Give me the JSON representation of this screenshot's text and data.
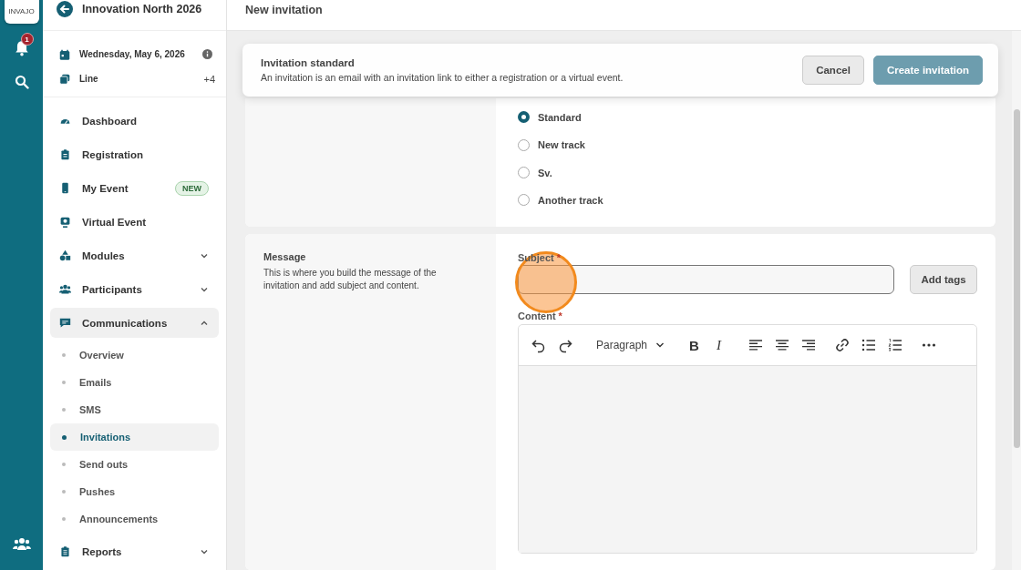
{
  "app": {
    "logo": "INVAJO",
    "notification_count": "1"
  },
  "sidebar": {
    "event_title": "Innovation North 2026",
    "date": "Wednesday, May 6, 2026",
    "line": {
      "label": "Line",
      "extra": "+4"
    },
    "items": [
      {
        "label": "Dashboard",
        "selected": false
      },
      {
        "label": "Registration",
        "selected": false
      },
      {
        "label": "My Event",
        "badge": "NEW",
        "selected": false
      },
      {
        "label": "Virtual Event",
        "selected": false
      },
      {
        "label": "Modules",
        "expanded": false,
        "selected": false
      },
      {
        "label": "Participants",
        "expanded": false,
        "selected": false
      },
      {
        "label": "Communications",
        "expanded": true,
        "selected": false,
        "children": [
          {
            "label": "Overview",
            "selected": false
          },
          {
            "label": "Emails",
            "selected": false
          },
          {
            "label": "SMS",
            "selected": false
          },
          {
            "label": "Invitations",
            "selected": true
          },
          {
            "label": "Send outs",
            "selected": false
          },
          {
            "label": "Pushes",
            "selected": false
          },
          {
            "label": "Announcements",
            "selected": false
          }
        ]
      },
      {
        "label": "Reports",
        "expanded": false,
        "selected": false
      }
    ]
  },
  "page_title": "New invitation",
  "banner": {
    "title": "Invitation standard",
    "description": "An invitation is an email with an invitation link to either a registration or a virtual event.",
    "buttons": [
      {
        "label": "Cancel",
        "kind": "secondary"
      },
      {
        "label": "Create invitation",
        "kind": "primary"
      }
    ]
  },
  "track_options": [
    {
      "label": "Standard",
      "selected": true
    },
    {
      "label": "New track",
      "selected": false
    },
    {
      "label": "Sv.",
      "selected": false
    },
    {
      "label": "Another track",
      "selected": false
    }
  ],
  "message": {
    "title": "Message",
    "description": "This is where you build the message of the invitation and add subject and content.",
    "subject": {
      "label": "Subject",
      "required_mark": "*"
    },
    "add_tags": "Add tags",
    "content": {
      "label": "Content",
      "required_mark": "*"
    },
    "toolbar": {
      "block_style": "Paragraph",
      "bold": "B",
      "italic": "I"
    }
  }
}
